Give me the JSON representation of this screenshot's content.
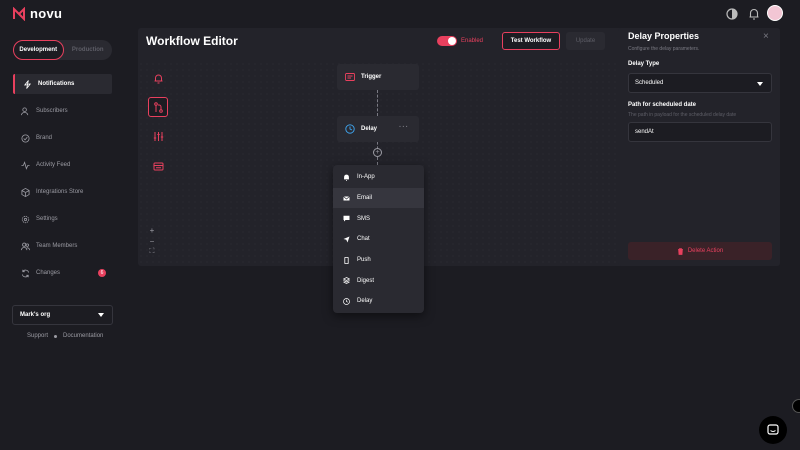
{
  "app": {
    "logo_text": "novu"
  },
  "colors": {
    "accent": "#e8405e",
    "background": "#1c1c22",
    "surface": "#23232a"
  },
  "env": {
    "development": "Development",
    "production": "Production"
  },
  "sidebar": {
    "items": [
      {
        "label": "Notifications",
        "icon": "lightning-icon"
      },
      {
        "label": "Subscribers",
        "icon": "users-icon"
      },
      {
        "label": "Brand",
        "icon": "check-circle-icon"
      },
      {
        "label": "Activity Feed",
        "icon": "activity-icon"
      },
      {
        "label": "Integrations Store",
        "icon": "box-icon"
      },
      {
        "label": "Settings",
        "icon": "gear-icon"
      },
      {
        "label": "Team Members",
        "icon": "team-icon"
      },
      {
        "label": "Changes",
        "icon": "sync-icon",
        "badge": "6"
      }
    ],
    "org": "Mark's org",
    "support": "Support",
    "documentation": "Documentation"
  },
  "editor": {
    "title": "Workflow Editor",
    "toggle_label": "Enabled",
    "test_button": "Test Workflow",
    "update_button": "Update",
    "nodes": {
      "trigger": "Trigger",
      "delay": "Delay"
    },
    "zoom_in": "+",
    "zoom_out": "−",
    "fit": "⛶"
  },
  "menu": {
    "items": [
      "In-App",
      "Email",
      "SMS",
      "Chat",
      "Push",
      "Digest",
      "Delay"
    ]
  },
  "panel": {
    "title": "Delay Properties",
    "subtitle": "Configure the delay parameters.",
    "close": "×",
    "delay_type_label": "Delay Type",
    "delay_type_value": "Scheduled",
    "path_label": "Path for scheduled date",
    "path_hint": "The path in payload for the scheduled delay date",
    "path_value": "sendAt",
    "delete_button": "Delete Action"
  }
}
